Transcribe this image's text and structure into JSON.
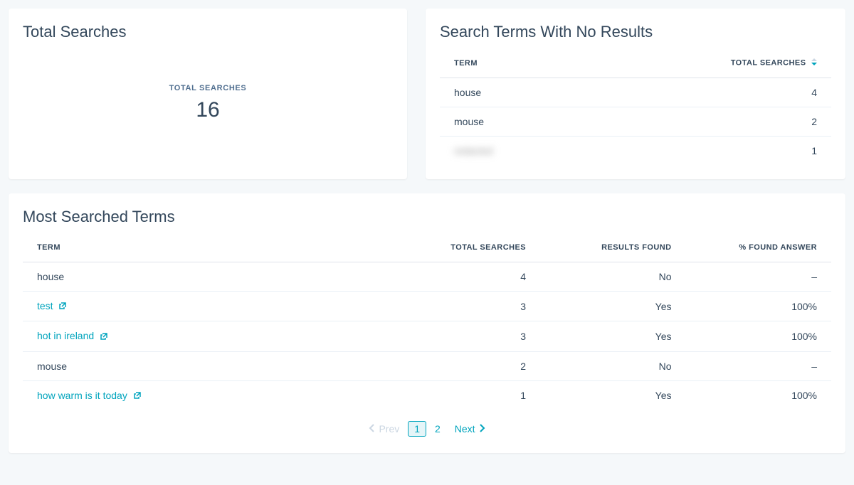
{
  "total_searches_card": {
    "title": "Total Searches",
    "label": "TOTAL SEARCHES",
    "value": "16"
  },
  "no_results_card": {
    "title": "Search Terms With No Results",
    "headers": {
      "term": "TERM",
      "total": "TOTAL SEARCHES"
    },
    "rows": [
      {
        "term": "house",
        "total": "4",
        "blurred": false
      },
      {
        "term": "mouse",
        "total": "2",
        "blurred": false
      },
      {
        "term": "redacted",
        "total": "1",
        "blurred": true
      }
    ]
  },
  "most_searched_card": {
    "title": "Most Searched Terms",
    "headers": {
      "term": "TERM",
      "total": "TOTAL SEARCHES",
      "results": "RESULTS FOUND",
      "pct": "% FOUND ANSWER"
    },
    "rows": [
      {
        "term": "house",
        "link": false,
        "total": "4",
        "results": "No",
        "pct": "–"
      },
      {
        "term": "test",
        "link": true,
        "total": "3",
        "results": "Yes",
        "pct": "100%"
      },
      {
        "term": "hot in ireland",
        "link": true,
        "total": "3",
        "results": "Yes",
        "pct": "100%"
      },
      {
        "term": "mouse",
        "link": false,
        "total": "2",
        "results": "No",
        "pct": "–"
      },
      {
        "term": "how warm is it today",
        "link": true,
        "total": "1",
        "results": "Yes",
        "pct": "100%"
      }
    ]
  },
  "pagination": {
    "prev": "Prev",
    "next": "Next",
    "pages": [
      "1",
      "2"
    ],
    "active": "1"
  },
  "colors": {
    "accent": "#00a4bd",
    "text": "#33475b",
    "muted": "#cbd6e2"
  }
}
